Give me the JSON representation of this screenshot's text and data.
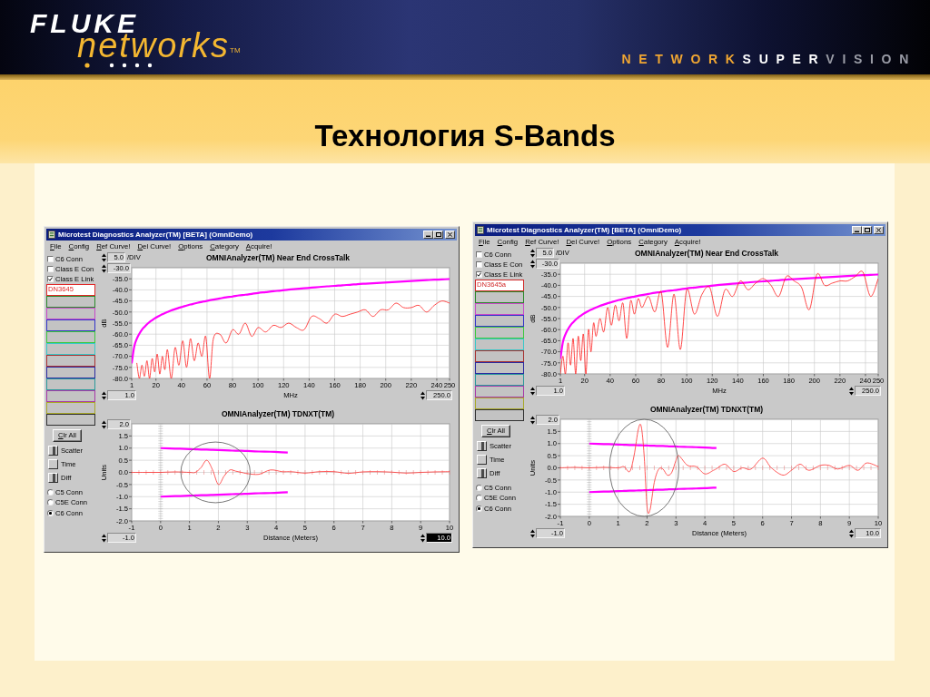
{
  "header": {
    "logo": {
      "brand": "FLUKE",
      "product": "networks",
      "mark": "TM"
    },
    "tagline": [
      {
        "text": "NETWORK",
        "color": "#f0a632"
      },
      {
        "text": "SUPER",
        "color": "#ffffff"
      },
      {
        "text": "VISION",
        "color": "#9a9ca6"
      }
    ]
  },
  "slide": {
    "title": "Технология S-Bands"
  },
  "windows": [
    {
      "title": "Microtest Diagnostics Analyzer(TM) [BETA] (OmniDemo)",
      "menu": [
        "File",
        "Config",
        "Ref Curve!",
        "Del Curve!",
        "Options",
        "Category",
        "Acquire!"
      ],
      "filters": [
        {
          "label": "C6 Conn",
          "checked": false
        },
        {
          "label": "Class E Con",
          "checked": false
        },
        {
          "label": "Class E Link",
          "checked": true
        }
      ],
      "traces": [
        {
          "label": "DN3645",
          "color": "#e02828"
        },
        {
          "color": "#2a8a2a"
        },
        {
          "color": "#c848c8"
        },
        {
          "color": "#3434c8"
        },
        {
          "color": "#3cc83c"
        },
        {
          "color": "#38c8c8"
        },
        {
          "color": "#a83030"
        },
        {
          "color": "#2a2aa0"
        },
        {
          "color": "#2a9a9a"
        },
        {
          "color": "#a838a8"
        },
        {
          "color": "#a8a828"
        },
        {
          "color": "#303030"
        }
      ],
      "clear_button": "Clr All",
      "toggles": [
        {
          "label": "Scatter",
          "on": true
        },
        {
          "label": "Time",
          "on": false
        },
        {
          "label": "Diff",
          "on": true
        }
      ],
      "connectors": [
        {
          "label": "C5 Conn",
          "selected": false
        },
        {
          "label": "C5E Conn",
          "selected": false
        },
        {
          "label": "C6 Conn",
          "selected": true
        }
      ],
      "panels": [
        {
          "scale": {
            "value": "5.0",
            "unit": "/DIV",
            "highlighted": false
          },
          "y_max": {
            "value": "-30.0",
            "highlighted": false
          },
          "x_min": {
            "value": "1.0",
            "highlighted": false
          },
          "x_max": {
            "value": "250.0",
            "highlighted": false
          },
          "chart_data": {
            "type": "line",
            "title": "OMNIAnalyzer(TM) Near End CrossTalk",
            "xlabel": "MHz",
            "ylabel": "dB",
            "grid": true,
            "x": [
              1,
              3,
              5,
              7,
              9,
              11,
              13,
              15,
              17,
              19,
              21,
              23,
              25,
              27,
              29,
              32,
              35,
              38,
              41,
              44,
              47,
              50,
              53,
              56,
              59,
              62,
              65,
              70,
              75,
              80,
              85,
              90,
              95,
              100,
              106,
              112,
              118,
              124,
              130,
              136,
              142,
              148,
              154,
              160,
              166,
              172,
              178,
              184,
              190,
              196,
              202,
              208,
              214,
              220,
              226,
              232,
              238,
              244,
              250
            ],
            "series": [
              {
                "color": "#ff00ff",
                "values": [
                  -73.2,
                  -65.6,
                  -62.1,
                  -59.8,
                  -58.0,
                  -56.7,
                  -55.5,
                  -54.5,
                  -53.7,
                  -52.9,
                  -52.2,
                  -51.6,
                  -51.0,
                  -50.5,
                  -50.0,
                  -49.3,
                  -48.7,
                  -48.1,
                  -47.6,
                  -47.1,
                  -46.6,
                  -46.2,
                  -45.8,
                  -45.4,
                  -45.1,
                  -44.7,
                  -44.4,
                  -43.9,
                  -43.4,
                  -43.0,
                  -42.5,
                  -42.2,
                  -41.8,
                  -41.4,
                  -41.0,
                  -40.6,
                  -40.3,
                  -39.9,
                  -39.6,
                  -39.3,
                  -39.0,
                  -38.7,
                  -38.4,
                  -38.2,
                  -37.9,
                  -37.7,
                  -37.4,
                  -37.2,
                  -37.0,
                  -36.8,
                  -36.6,
                  -36.4,
                  -36.2,
                  -36.0,
                  -35.8,
                  -35.6,
                  -35.4,
                  -35.3,
                  -35.1
                ]
              },
              {
                "color": "#ff1a1a",
                "values": [
                  null,
                  null,
                  -73,
                  -80,
                  -74,
                  -79,
                  -72,
                  -80,
                  -71,
                  -77,
                  -69,
                  -78,
                  -70,
                  -76,
                  -67,
                  -80,
                  -66,
                  -74,
                  -63,
                  -75,
                  -62,
                  -72,
                  -64,
                  -70,
                  -61,
                  -80,
                  -62,
                  -60,
                  -64,
                  -58,
                  -60,
                  -55,
                  -61,
                  -57,
                  -59,
                  -56,
                  -57,
                  -55,
                  -57,
                  -58,
                  -52,
                  -53,
                  -55,
                  -51,
                  -52,
                  -51,
                  -50,
                  -49,
                  -52,
                  -49,
                  -49,
                  -46,
                  -48,
                  -48,
                  -47,
                  -50,
                  -47,
                  -45,
                  -46
                ]
              }
            ],
            "xlim": [
              1,
              250
            ],
            "ylim": [
              -80,
              -30
            ],
            "xticks": [
              1,
              20,
              40,
              60,
              80,
              100,
              120,
              140,
              160,
              180,
              200,
              220,
              240,
              250
            ],
            "yticks": [
              {
                "value": -80,
                "label": "-80.0"
              },
              {
                "value": -75,
                "label": "-75.0"
              },
              {
                "value": -70,
                "label": "-70.0"
              },
              {
                "value": -65,
                "label": "-65.0"
              },
              {
                "value": -60,
                "label": "-60.0"
              },
              {
                "value": -55,
                "label": "-55.0"
              },
              {
                "value": -50,
                "label": "-50.0"
              },
              {
                "value": -45,
                "label": "-45.0"
              },
              {
                "value": -40,
                "label": "-40.0"
              },
              {
                "value": -35,
                "label": "-35.0"
              }
            ]
          }
        },
        {
          "y_max": {
            "value": "2.0",
            "highlighted": false
          },
          "x_min": {
            "value": "-1.0",
            "highlighted": false
          },
          "x_max": {
            "value": "10.0",
            "highlighted": true
          },
          "highlight_ring": true,
          "chart_data": {
            "type": "line",
            "title": "OMNIAnalyzer(TM) TDNXT(TM)",
            "xlabel": "Distance (Meters)",
            "ylabel": "Units",
            "grid": true,
            "x": [
              -1,
              -0.5,
              0,
              0.5,
              1,
              1.2,
              1.4,
              1.6,
              1.8,
              2,
              2.2,
              2.4,
              2.6,
              2.8,
              3,
              3.4,
              3.8,
              4.2,
              4.4,
              4.6,
              5,
              5.5,
              6,
              6.5,
              7,
              7.5,
              8,
              8.5,
              9,
              9.5,
              10
            ],
            "series": [
              {
                "color": "#ff00ff",
                "values": [
                  null,
                  null,
                  1.0,
                  0.98,
                  0.96,
                  0.95,
                  0.94,
                  0.94,
                  0.93,
                  0.92,
                  0.91,
                  0.9,
                  0.89,
                  0.89,
                  0.88,
                  0.86,
                  0.85,
                  0.83,
                  0.82,
                  null,
                  null,
                  null,
                  null,
                  null,
                  null,
                  null,
                  null,
                  null,
                  null,
                  null,
                  null
                ]
              },
              {
                "color": "#ff00ff",
                "values": [
                  null,
                  null,
                  -1.0,
                  -0.98,
                  -0.96,
                  -0.95,
                  -0.94,
                  -0.94,
                  -0.93,
                  -0.92,
                  -0.91,
                  -0.9,
                  -0.89,
                  -0.89,
                  -0.88,
                  -0.86,
                  -0.85,
                  -0.83,
                  -0.82,
                  null,
                  null,
                  null,
                  null,
                  null,
                  null,
                  null,
                  null,
                  null,
                  null,
                  null,
                  null
                ]
              },
              {
                "color": "#ff3030",
                "values": [
                  0,
                  0,
                  0,
                  0.02,
                  0,
                  0,
                  0.2,
                  0.5,
                  0.1,
                  -0.5,
                  -0.15,
                  0.1,
                  0.05,
                  0,
                  -0.05,
                  -0.08,
                  0.1,
                  0.03,
                  0.03,
                  0.02,
                  -0.03,
                  0.03,
                  0.03,
                  -0.04,
                  0.02,
                  0.03,
                  0.01,
                  -0.03,
                  0,
                  0.02,
                  0.03
                ]
              }
            ],
            "xlim": [
              -1,
              10
            ],
            "ylim": [
              -2,
              2
            ],
            "xticks": [
              -1,
              0,
              1,
              2,
              3,
              4,
              5,
              6,
              7,
              8,
              9,
              10
            ],
            "yticks": [
              {
                "value": -2,
                "label": "-2.0"
              },
              {
                "value": -1.5,
                "label": "-1.5"
              },
              {
                "value": -1,
                "label": "-1.0"
              },
              {
                "value": -0.5,
                "label": "-0.5"
              },
              {
                "value": 0,
                "label": "0.0"
              },
              {
                "value": 0.5,
                "label": "0.5"
              },
              {
                "value": 1,
                "label": "1.0"
              },
              {
                "value": 1.5,
                "label": "1.5"
              }
            ]
          }
        }
      ]
    },
    {
      "title": "Microtest Diagnostics Analyzer(TM) [BETA] (OmniDemo)",
      "menu": [
        "File",
        "Config",
        "Ref Curve!",
        "Del Curve!",
        "Options",
        "Category",
        "Acquire!"
      ],
      "filters": [
        {
          "label": "C6 Conn",
          "checked": false
        },
        {
          "label": "Class E Con",
          "checked": false
        },
        {
          "label": "Class E Link",
          "checked": true
        }
      ],
      "traces": [
        {
          "label": "DN3645a",
          "color": "#d02828"
        },
        {
          "color": "#2a8a2a"
        },
        {
          "color": "#c848c8"
        },
        {
          "color": "#3434c8"
        },
        {
          "color": "#3cc83c"
        },
        {
          "color": "#38c8c8"
        },
        {
          "color": "#a83030"
        },
        {
          "color": "#2a2aa0"
        },
        {
          "color": "#2a9a9a"
        },
        {
          "color": "#a838a8"
        },
        {
          "color": "#a8a828"
        },
        {
          "color": "#303030"
        }
      ],
      "clear_button": "Clr All",
      "toggles": [
        {
          "label": "Scatter",
          "on": true
        },
        {
          "label": "Time",
          "on": false
        },
        {
          "label": "Diff",
          "on": true
        }
      ],
      "connectors": [
        {
          "label": "C5 Conn",
          "selected": false
        },
        {
          "label": "C5E Conn",
          "selected": false
        },
        {
          "label": "C6 Conn",
          "selected": true
        }
      ],
      "panels": [
        {
          "scale": {
            "value": "5.0",
            "unit": "/DIV",
            "highlighted": false
          },
          "y_max": {
            "value": "-30.0",
            "highlighted": false
          },
          "x_min": {
            "value": "1.0",
            "highlighted": false
          },
          "x_max": {
            "value": "250.0",
            "highlighted": false
          },
          "chart_data": {
            "type": "line",
            "title": "OMNIAnalyzer(TM) Near End CrossTalk",
            "xlabel": "MHz",
            "ylabel": "dB",
            "grid": true,
            "x": [
              1,
              3,
              5,
              7,
              9,
              11,
              13,
              15,
              17,
              19,
              21,
              23,
              25,
              27,
              29,
              32,
              35,
              38,
              41,
              44,
              47,
              50,
              53,
              56,
              59,
              62,
              65,
              70,
              75,
              80,
              85,
              90,
              95,
              100,
              106,
              112,
              118,
              124,
              130,
              136,
              142,
              148,
              154,
              160,
              166,
              172,
              178,
              184,
              190,
              196,
              202,
              208,
              214,
              220,
              226,
              232,
              238,
              244,
              250
            ],
            "series": [
              {
                "color": "#ff00ff",
                "values": [
                  -73.2,
                  -65.6,
                  -62.1,
                  -59.8,
                  -58.0,
                  -56.7,
                  -55.5,
                  -54.5,
                  -53.7,
                  -52.9,
                  -52.2,
                  -51.6,
                  -51.0,
                  -50.5,
                  -50.0,
                  -49.3,
                  -48.7,
                  -48.1,
                  -47.6,
                  -47.1,
                  -46.6,
                  -46.2,
                  -45.8,
                  -45.4,
                  -45.1,
                  -44.7,
                  -44.4,
                  -43.9,
                  -43.4,
                  -43.0,
                  -42.5,
                  -42.2,
                  -41.8,
                  -41.4,
                  -41.0,
                  -40.6,
                  -40.3,
                  -39.9,
                  -39.6,
                  -39.3,
                  -39.0,
                  -38.7,
                  -38.4,
                  -38.2,
                  -37.9,
                  -37.7,
                  -37.4,
                  -37.2,
                  -37.0,
                  -36.8,
                  -36.6,
                  -36.4,
                  -36.2,
                  -36.0,
                  -35.8,
                  -35.6,
                  -35.4,
                  -35.3,
                  -35.1
                ]
              },
              {
                "color": "#ff1a1a",
                "values": [
                  -80,
                  -72,
                  -80,
                  -66,
                  -76,
                  -64,
                  -80,
                  -63,
                  -74,
                  -62,
                  -80,
                  -60,
                  -70,
                  -57,
                  -63,
                  -55,
                  -61,
                  -50,
                  -58,
                  -49,
                  -56,
                  -48,
                  -64,
                  -47,
                  -53,
                  -46,
                  -50,
                  -45,
                  -52,
                  -43,
                  -68,
                  -44,
                  -69,
                  -42,
                  -53,
                  -44,
                  -41,
                  -54,
                  -42,
                  -45,
                  -38,
                  -42,
                  -39,
                  -37,
                  -40,
                  -45,
                  -36,
                  -38,
                  -41,
                  -51,
                  -35,
                  -40,
                  -39,
                  -38,
                  -38,
                  -36,
                  -34,
                  -45,
                  -37
                ]
              }
            ],
            "xlim": [
              1,
              250
            ],
            "ylim": [
              -80,
              -30
            ],
            "xticks": [
              1,
              20,
              40,
              60,
              80,
              100,
              120,
              140,
              160,
              180,
              200,
              220,
              240,
              250
            ],
            "yticks": [
              {
                "value": -80,
                "label": "-80.0"
              },
              {
                "value": -75,
                "label": "-75.0"
              },
              {
                "value": -70,
                "label": "-70.0"
              },
              {
                "value": -65,
                "label": "-65.0"
              },
              {
                "value": -60,
                "label": "-60.0"
              },
              {
                "value": -55,
                "label": "-55.0"
              },
              {
                "value": -50,
                "label": "-50.0"
              },
              {
                "value": -45,
                "label": "-45.0"
              },
              {
                "value": -40,
                "label": "-40.0"
              },
              {
                "value": -35,
                "label": "-35.0"
              }
            ]
          }
        },
        {
          "y_max": {
            "value": "2.0",
            "highlighted": false
          },
          "x_min": {
            "value": "-1.0",
            "highlighted": false
          },
          "x_max": {
            "value": "10.0",
            "highlighted": false
          },
          "highlight_ring": true,
          "chart_data": {
            "type": "line",
            "title": "OMNIAnalyzer(TM) TDNXT(TM)",
            "xlabel": "Distance (Meters)",
            "ylabel": "Units",
            "grid": true,
            "x": [
              -1,
              -0.5,
              0,
              0.5,
              1,
              1.2,
              1.4,
              1.55,
              1.7,
              1.8,
              1.9,
              2.0,
              2.1,
              2.25,
              2.4,
              2.55,
              2.7,
              2.85,
              3.0,
              3.1,
              3.4,
              3.7,
              4.0,
              4.3,
              4.4,
              4.7,
              5.0,
              5.3,
              5.6,
              6.0,
              6.3,
              6.7,
              7.0,
              7.3,
              7.6,
              8.0,
              8.3,
              8.6,
              9.0,
              9.3,
              9.6,
              10
            ],
            "series": [
              {
                "color": "#ff00ff",
                "values": [
                  null,
                  null,
                  1.0,
                  0.98,
                  0.96,
                  0.95,
                  0.94,
                  0.94,
                  0.93,
                  0.93,
                  0.92,
                  0.92,
                  0.91,
                  0.91,
                  0.9,
                  0.9,
                  0.89,
                  0.88,
                  0.88,
                  0.87,
                  0.86,
                  0.85,
                  0.84,
                  0.82,
                  0.82,
                  null,
                  null,
                  null,
                  null,
                  null,
                  null,
                  null,
                  null,
                  null,
                  null,
                  null,
                  null,
                  null,
                  null,
                  null,
                  null,
                  null
                ]
              },
              {
                "color": "#ff00ff",
                "values": [
                  null,
                  null,
                  -1.0,
                  -0.98,
                  -0.96,
                  -0.95,
                  -0.94,
                  -0.94,
                  -0.93,
                  -0.93,
                  -0.92,
                  -0.92,
                  -0.91,
                  -0.91,
                  -0.9,
                  -0.9,
                  -0.89,
                  -0.88,
                  -0.88,
                  -0.87,
                  -0.86,
                  -0.85,
                  -0.84,
                  -0.82,
                  -0.82,
                  null,
                  null,
                  null,
                  null,
                  null,
                  null,
                  null,
                  null,
                  null,
                  null,
                  null,
                  null,
                  null,
                  null,
                  null,
                  null,
                  null
                ]
              },
              {
                "color": "#ff3030",
                "values": [
                  0,
                  0.02,
                  0,
                  0.02,
                  0,
                  0.05,
                  -0.15,
                  0.5,
                  1.6,
                  1.7,
                  0.5,
                  -1.6,
                  -1.75,
                  -0.6,
                  -0.06,
                  -0.05,
                  -0.3,
                  -0.2,
                  0.3,
                  0.5,
                  0.1,
                  0.05,
                  -0.25,
                  -0.1,
                  -0.04,
                  0.15,
                  -0.15,
                  0.0,
                  -0.05,
                  0.4,
                  0.0,
                  -0.3,
                  -0.1,
                  0.15,
                  -0.1,
                  0.1,
                  0.1,
                  -0.05,
                  0.1,
                  -0.1,
                  0.2,
                  0.05
                ]
              }
            ],
            "xlim": [
              -1,
              10
            ],
            "ylim": [
              -2,
              2
            ],
            "xticks": [
              -1,
              0,
              1,
              2,
              3,
              4,
              5,
              6,
              7,
              8,
              9,
              10
            ],
            "yticks": [
              {
                "value": -2,
                "label": "-2.0"
              },
              {
                "value": -1.5,
                "label": "-1.5"
              },
              {
                "value": -1,
                "label": "-1.0"
              },
              {
                "value": -0.5,
                "label": "-0.5"
              },
              {
                "value": 0,
                "label": "0.0"
              },
              {
                "value": 0.5,
                "label": "0.5"
              },
              {
                "value": 1,
                "label": "1.0"
              },
              {
                "value": 1.5,
                "label": "1.5"
              }
            ]
          }
        }
      ]
    }
  ]
}
